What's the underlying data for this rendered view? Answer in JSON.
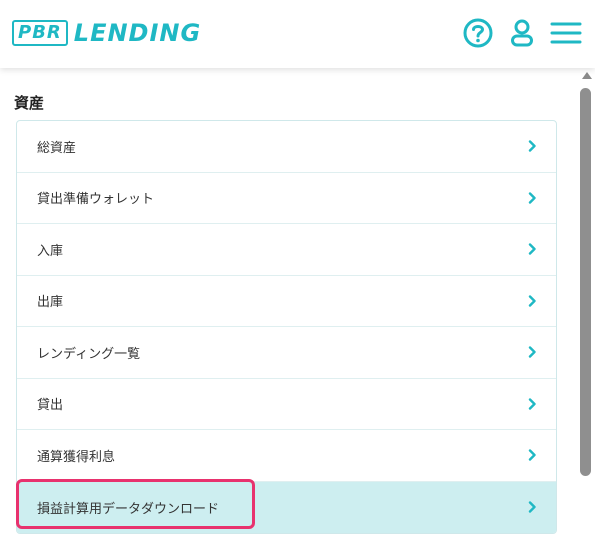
{
  "header": {
    "logo_box": "PBR",
    "logo_text": "LENDING",
    "accent_color": "#1fb8c4",
    "icons": [
      "help-icon",
      "user-icon",
      "menu-icon"
    ]
  },
  "section": {
    "title": "資産"
  },
  "menu": {
    "items": [
      {
        "label": "総資産"
      },
      {
        "label": "貸出準備ウォレット"
      },
      {
        "label": "入庫"
      },
      {
        "label": "出庫"
      },
      {
        "label": "レンディング一覧"
      },
      {
        "label": "貸出"
      },
      {
        "label": "通算獲得利息"
      },
      {
        "label": "損益計算用データダウンロード",
        "selected": true
      }
    ]
  },
  "highlight_color": "#e8326e"
}
